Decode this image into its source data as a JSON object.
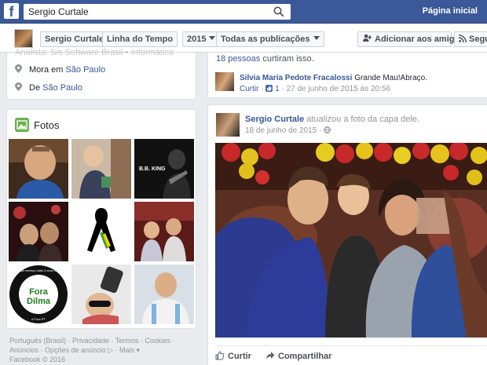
{
  "topbar": {
    "logo": "f",
    "search_value": "Sergio Curtale",
    "home_link": "Página inicial",
    "icons": {
      "search": "search-icon"
    },
    "colors": {
      "brand": "#3b5998"
    }
  },
  "navbar": {
    "name": "Sergio Curtale",
    "timeline": "Linha do Tempo",
    "year": "2015",
    "filter": "Todas as publicações",
    "add_friend": "Adicionar aos amigos",
    "follow": "Seguir"
  },
  "about": {
    "truncated": "Analista: Sis Software Brasil • Informática",
    "lives_prefix": "Mora em",
    "lives_city": "São Paulo",
    "from_prefix": "De",
    "from_city": "São Paulo"
  },
  "photos": {
    "title": "Fotos",
    "tile2_label": "B.B. KING",
    "tile7_line1": "Fora",
    "tile7_line2": "Dilma",
    "tile7_ring_top": "Eu não mereço mais 4 anos de PT",
    "tile7_ring_bottom": "# Fora PT"
  },
  "footer": {
    "line1": "Português (Brasil) · Privacidade · Termos · Cookies ·",
    "line2": "Anúncios · Opções de anúncio ▷ · Mais ▾",
    "line3": "Facebook © 2016"
  },
  "comments": {
    "likes_count": "18 pessoas",
    "likes_suffix": " curtiram isso.",
    "author": "Silvia Maria Pedote Fracalossi",
    "text": "Grande Mau!Abraço.",
    "like_action": "Curtir",
    "like_count": "1",
    "timestamp": "27 de junho de 2015 às 20:56"
  },
  "post": {
    "author": "Sergio Curtale",
    "action": "atualizou a foto da capa dele.",
    "date": "18 de junho de 2015",
    "like": "Curtir",
    "share": "Compartilhar"
  }
}
